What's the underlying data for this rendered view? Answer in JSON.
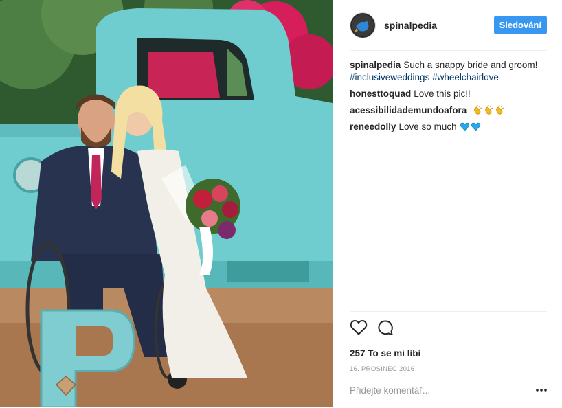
{
  "header": {
    "username": "spinalpedia",
    "follow_label": "Sledování"
  },
  "caption": {
    "username": "spinalpedia",
    "text": "Such a snappy bride and groom!",
    "hashtags": [
      "#inclusiveweddings",
      "#wheelchairlove"
    ]
  },
  "comments": [
    {
      "username": "honesttoquad",
      "text": "Love this pic!!"
    },
    {
      "username": "acessibilidademundoafora",
      "text": "",
      "emoji": [
        "clapping-hands",
        "clapping-hands",
        "clapping-hands"
      ]
    },
    {
      "username": "reneedolly",
      "text": "Love so much",
      "emoji": [
        "blue-heart",
        "blue-heart"
      ]
    }
  ],
  "actions": {
    "likes_text": "257 To se mi líbí",
    "date": "16. PROSINEC 2016"
  },
  "add_comment": {
    "placeholder": "Přidejte komentář..."
  },
  "icons": [
    "heart-icon",
    "comment-icon",
    "more-options-icon"
  ],
  "colors": {
    "accent": "#3897f0",
    "hashtag": "#003569",
    "muted": "#999999",
    "truck": "#6cc7c9"
  },
  "photo": {
    "letter": "P"
  }
}
